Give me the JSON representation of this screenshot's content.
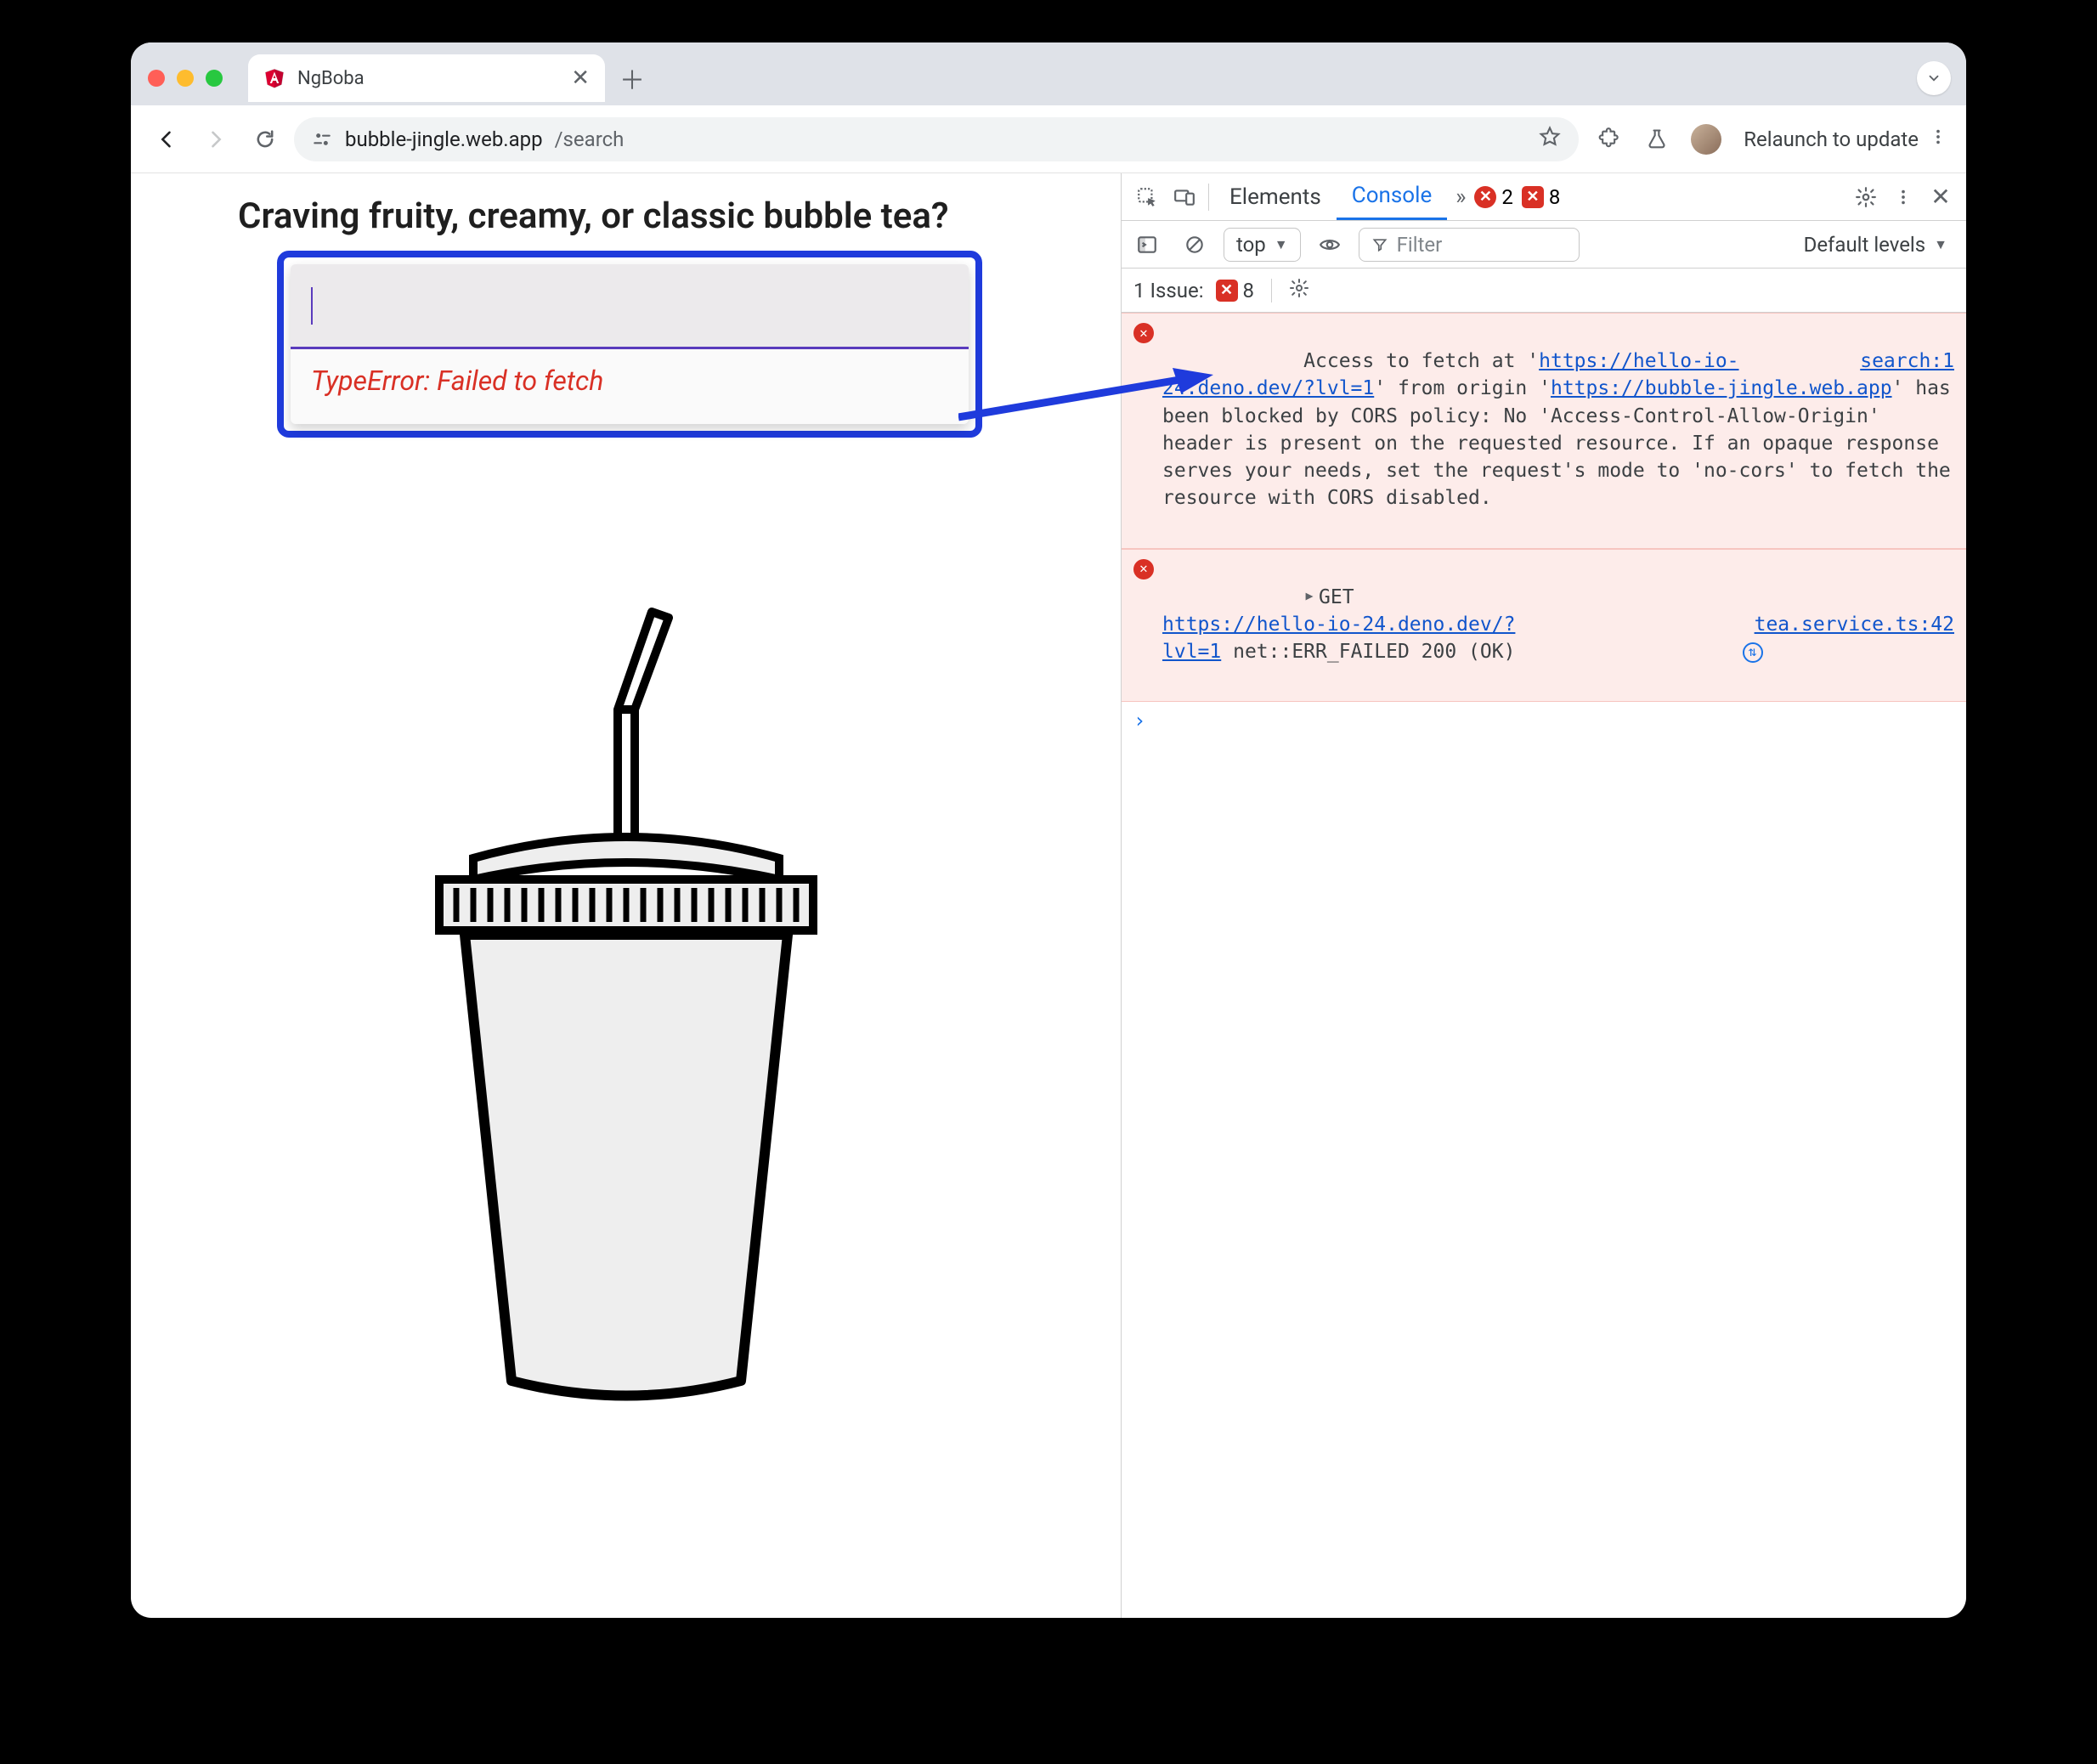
{
  "browser": {
    "tab_title": "NgBoba",
    "url_host": "bubble-jingle.web.app",
    "url_path": "/search",
    "relaunch_label": "Relaunch to update"
  },
  "page": {
    "heading": "Craving fruity, creamy, or classic bubble tea?",
    "search_value": "",
    "error_message": "TypeError: Failed to fetch"
  },
  "devtools": {
    "tabs": {
      "elements": "Elements",
      "console": "Console"
    },
    "error_count": "2",
    "issue_badge_count": "8",
    "context_label": "top",
    "filter_placeholder": "Filter",
    "levels_label": "Default levels",
    "issues_label": "1 Issue:",
    "issues_count": "8",
    "entries": [
      {
        "source": "search:1",
        "pre1": "Access to fetch at '",
        "url1": "https://hello-io-24.deno.dev/?lvl=1",
        "mid1": "' from origin '",
        "url2": "https://bubble-jingle.web.app",
        "post": "' has been blocked by CORS policy: No 'Access-Control-Allow-Origin' header is present on the requested resource. If an opaque response serves your needs, set the request's mode to 'no-cors' to fetch the resource with CORS disabled."
      },
      {
        "source": "tea.service.ts:42",
        "method": "GET",
        "url": "https://hello-io-24.deno.dev/?lvl=1",
        "tail": " net::ERR_FAILED 200 (OK)"
      }
    ]
  }
}
